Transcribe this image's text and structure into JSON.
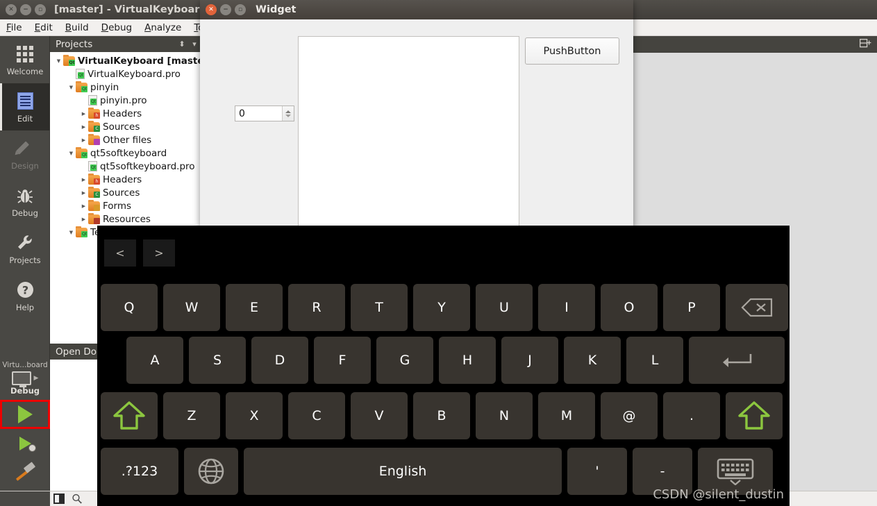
{
  "qtcreator": {
    "title": "[master] - VirtualKeyboard - Q",
    "window_controls": [
      "close",
      "minimize",
      "maximize"
    ],
    "menu": [
      {
        "label": "File",
        "mnemonic": "F"
      },
      {
        "label": "Edit",
        "mnemonic": "E"
      },
      {
        "label": "Build",
        "mnemonic": "B"
      },
      {
        "label": "Debug",
        "mnemonic": "D"
      },
      {
        "label": "Analyze",
        "mnemonic": "A"
      },
      {
        "label": "To",
        "mnemonic": "T"
      }
    ],
    "modebar": [
      {
        "label": "Welcome",
        "icon": "grid-icon",
        "state": "normal"
      },
      {
        "label": "Edit",
        "icon": "document-icon",
        "state": "active"
      },
      {
        "label": "Design",
        "icon": "pencil-icon",
        "state": "disabled"
      },
      {
        "label": "Debug",
        "icon": "bug-icon",
        "state": "normal"
      },
      {
        "label": "Projects",
        "icon": "wrench-icon",
        "state": "normal"
      },
      {
        "label": "Help",
        "icon": "question-icon",
        "state": "normal"
      }
    ],
    "projects_dock": {
      "title": "Projects",
      "filter_icon": "filter-icon",
      "menu_icon": "chevron-down-icon",
      "tree": [
        {
          "label": "VirtualKeyboard [master",
          "indent": 0,
          "arrow": "down",
          "icon": "folder-qt",
          "bold": true
        },
        {
          "label": "VirtualKeyboard.pro",
          "indent": 1,
          "arrow": "none",
          "icon": "file-qt",
          "bold": false
        },
        {
          "label": "pinyin",
          "indent": 1,
          "arrow": "down",
          "icon": "folder-qt",
          "bold": false
        },
        {
          "label": "pinyin.pro",
          "indent": 2,
          "arrow": "none",
          "icon": "file-qt",
          "bold": false
        },
        {
          "label": "Headers",
          "indent": 2,
          "arrow": "right",
          "icon": "folder-h",
          "bold": false
        },
        {
          "label": "Sources",
          "indent": 2,
          "arrow": "right",
          "icon": "folder-cpp",
          "bold": false
        },
        {
          "label": "Other files",
          "indent": 2,
          "arrow": "right",
          "icon": "folder-oth",
          "bold": false
        },
        {
          "label": "qt5softkeyboard",
          "indent": 1,
          "arrow": "down",
          "icon": "folder-qt",
          "bold": false
        },
        {
          "label": "qt5softkeyboard.pro",
          "indent": 2,
          "arrow": "none",
          "icon": "file-qt",
          "bold": false
        },
        {
          "label": "Headers",
          "indent": 2,
          "arrow": "right",
          "icon": "folder-h",
          "bold": false
        },
        {
          "label": "Sources",
          "indent": 2,
          "arrow": "right",
          "icon": "folder-cpp",
          "bold": false
        },
        {
          "label": "Forms",
          "indent": 2,
          "arrow": "right",
          "icon": "folder-frm",
          "bold": false
        },
        {
          "label": "Resources",
          "indent": 2,
          "arrow": "right",
          "icon": "folder-res",
          "bold": false
        },
        {
          "label": "TestKeyboard",
          "indent": 1,
          "arrow": "down",
          "icon": "folder-qt",
          "bold": false
        }
      ]
    },
    "open_documents": {
      "title": "Open Do"
    },
    "editor_toolbar": {
      "split_icon": "split-editor-icon"
    },
    "run_controls": {
      "kit_label": "Virtu...board",
      "build_config": "Debug",
      "monitor_icon": "monitor-icon",
      "expand_icon": "chevron-right-icon",
      "run_button": "run-icon",
      "run_highlight_color": "#ee0000",
      "debug_button": "run-debug-icon",
      "build_button": "hammer-icon"
    },
    "statusbar": {
      "sidebar_toggle_icon": "sidebar-toggle-icon",
      "search_icon": "search-icon"
    }
  },
  "widget_window": {
    "title": "Widget",
    "window_controls": [
      "close",
      "minimize",
      "maximize"
    ],
    "close_color": "#e2633a",
    "pushbutton_label": "PushButton",
    "spinbox_value": "0",
    "textarea_value": ""
  },
  "virtual_keyboard": {
    "background": "#000000",
    "key_color": "#38342f",
    "key_text_color": "#ffffff",
    "shift_color": "#8cc63f",
    "nav_keys": [
      {
        "label": "<",
        "name": "prev-candidate-button"
      },
      {
        "label": ">",
        "name": "next-candidate-button"
      }
    ],
    "rows": [
      {
        "name": "row-qwerty",
        "keys": [
          {
            "label": "Q",
            "type": "char"
          },
          {
            "label": "W",
            "type": "char"
          },
          {
            "label": "E",
            "type": "char"
          },
          {
            "label": "R",
            "type": "char"
          },
          {
            "label": "T",
            "type": "char"
          },
          {
            "label": "Y",
            "type": "char"
          },
          {
            "label": "U",
            "type": "char"
          },
          {
            "label": "I",
            "type": "char"
          },
          {
            "label": "O",
            "type": "char"
          },
          {
            "label": "P",
            "type": "char"
          },
          {
            "label": "",
            "type": "backspace",
            "icon": "backspace-icon"
          }
        ]
      },
      {
        "name": "row-asdf",
        "keys": [
          {
            "label": "A",
            "type": "char"
          },
          {
            "label": "S",
            "type": "char"
          },
          {
            "label": "D",
            "type": "char"
          },
          {
            "label": "F",
            "type": "char"
          },
          {
            "label": "G",
            "type": "char"
          },
          {
            "label": "H",
            "type": "char"
          },
          {
            "label": "J",
            "type": "char"
          },
          {
            "label": "K",
            "type": "char"
          },
          {
            "label": "L",
            "type": "char"
          },
          {
            "label": "",
            "type": "enter",
            "icon": "enter-icon"
          }
        ]
      },
      {
        "name": "row-zxcv",
        "keys": [
          {
            "label": "",
            "type": "shift",
            "icon": "shift-icon"
          },
          {
            "label": "Z",
            "type": "char"
          },
          {
            "label": "X",
            "type": "char"
          },
          {
            "label": "C",
            "type": "char"
          },
          {
            "label": "V",
            "type": "char"
          },
          {
            "label": "B",
            "type": "char"
          },
          {
            "label": "N",
            "type": "char"
          },
          {
            "label": "M",
            "type": "char"
          },
          {
            "label": "@",
            "type": "char"
          },
          {
            "label": ".",
            "type": "char"
          },
          {
            "label": "",
            "type": "shift",
            "icon": "shift-icon"
          }
        ]
      },
      {
        "name": "row-bottom",
        "keys": [
          {
            "label": ".?123",
            "type": "symbols"
          },
          {
            "label": "",
            "type": "language",
            "icon": "globe-icon"
          },
          {
            "label": "English",
            "type": "space"
          },
          {
            "label": "'",
            "type": "char"
          },
          {
            "label": "-",
            "type": "char"
          },
          {
            "label": "",
            "type": "hide",
            "icon": "hide-keyboard-icon"
          }
        ]
      }
    ]
  },
  "watermark": "CSDN @silent_dustin"
}
